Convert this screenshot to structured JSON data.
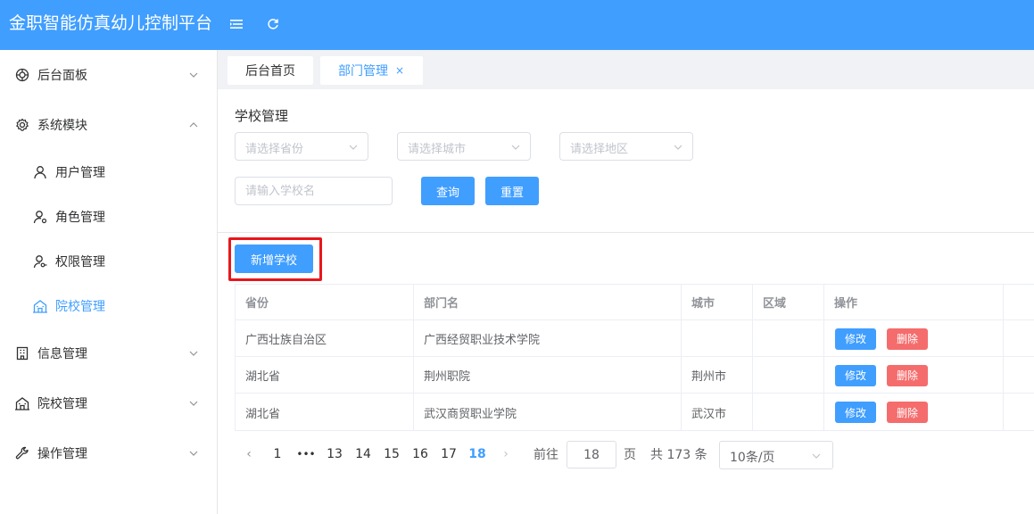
{
  "header": {
    "title": "金职智能仿真幼儿控制平台",
    "menu_toggle_icon": "menu-fold-icon",
    "refresh_icon": "refresh-icon"
  },
  "sidebar": {
    "menus": [
      {
        "label": "后台面板",
        "icon": "dashboard-icon",
        "expanded": false
      },
      {
        "label": "系统模块",
        "icon": "gear-icon",
        "expanded": true
      },
      {
        "label": "信息管理",
        "icon": "building-icon",
        "expanded": false
      },
      {
        "label": "院校管理",
        "icon": "school-icon",
        "expanded": false
      },
      {
        "label": "操作管理",
        "icon": "wrench-icon",
        "expanded": false
      }
    ],
    "sub_items": [
      {
        "label": "用户管理",
        "icon": "user-icon"
      },
      {
        "label": "角色管理",
        "icon": "user-gear-icon"
      },
      {
        "label": "权限管理",
        "icon": "user-key-icon"
      },
      {
        "label": "院校管理",
        "icon": "school-icon",
        "active": true
      }
    ]
  },
  "tabs": [
    {
      "label": "后台首页",
      "active": false
    },
    {
      "label": "部门管理",
      "active": true,
      "close": "×"
    }
  ],
  "filters": {
    "title": "学校管理",
    "province_placeholder": "请选择省份",
    "city_placeholder": "请选择城市",
    "district_placeholder": "请选择地区",
    "school_name_placeholder": "请输入学校名",
    "search_label": "查询",
    "reset_label": "重置"
  },
  "actions": {
    "add_school_label": "新增学校"
  },
  "table": {
    "columns": [
      "省份",
      "部门名",
      "城市",
      "区域",
      "操作"
    ],
    "rows": [
      {
        "province": "广西壮族自治区",
        "name": "广西经贸职业技术学院",
        "city": "",
        "district": ""
      },
      {
        "province": "湖北省",
        "name": "荆州职院",
        "city": "荆州市",
        "district": ""
      },
      {
        "province": "湖北省",
        "name": "武汉商贸职业学院",
        "city": "武汉市",
        "district": ""
      }
    ],
    "edit_label": "修改",
    "delete_label": "删除"
  },
  "pagination": {
    "prev": "‹",
    "next": "›",
    "pages": [
      "1",
      "•••",
      "13",
      "14",
      "15",
      "16",
      "17",
      "18"
    ],
    "current_page": "18",
    "goto_label": "前往",
    "goto_value": "18",
    "page_unit": "页",
    "total_text": "共 173 条",
    "page_size": "10条/页"
  },
  "colors": {
    "primary": "#409eff",
    "danger": "#f56c6c",
    "highlight": "#e8171c"
  }
}
